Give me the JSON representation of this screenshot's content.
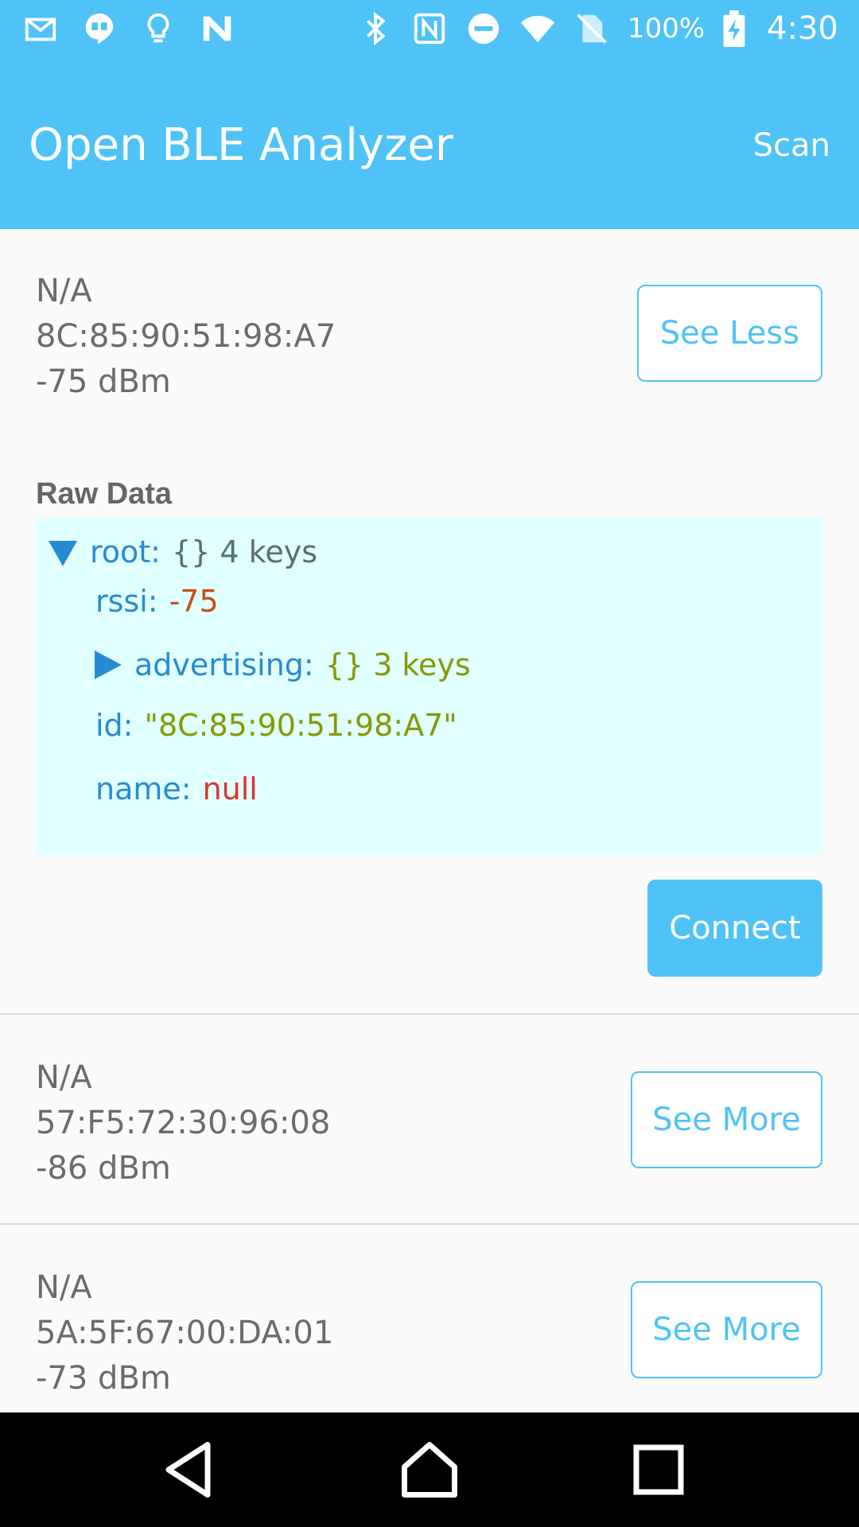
{
  "status_bar": {
    "left_icons": [
      "gmail-icon",
      "hangouts-icon",
      "lightbulb-icon",
      "n-logo-icon"
    ],
    "right_icons": [
      "bluetooth-icon",
      "nfc-icon",
      "do-not-disturb-icon",
      "wifi-icon",
      "no-sim-icon"
    ],
    "battery_percent": "100%",
    "time": "4:30"
  },
  "app_bar": {
    "title": "Open BLE Analyzer",
    "scan_label": "Scan"
  },
  "devices": [
    {
      "name": "N/A",
      "address": "8C:85:90:51:98:A7",
      "rssi": "-75 dBm",
      "toggle_label": "See Less",
      "expanded": true
    },
    {
      "name": "N/A",
      "address": "57:F5:72:30:96:08",
      "rssi": "-86 dBm",
      "toggle_label": "See More",
      "expanded": false
    },
    {
      "name": "N/A",
      "address": "5A:5F:67:00:DA:01",
      "rssi": "-73 dBm",
      "toggle_label": "See More",
      "expanded": false
    }
  ],
  "raw_data": {
    "heading": "Raw Data",
    "root_key": "root:",
    "root_summary": "{} 4 keys",
    "rssi_key": "rssi:",
    "rssi_value": "-75",
    "advertising_key": "advertising:",
    "advertising_summary": "{} 3 keys",
    "id_key": "id:",
    "id_value": "\"8C:85:90:51:98:A7\"",
    "name_key": "name:",
    "name_value": "null"
  },
  "connect_label": "Connect",
  "nav_bar": {
    "icons": [
      "back-icon",
      "home-icon",
      "recents-icon"
    ]
  },
  "colors": {
    "primary": "#4fc3f7",
    "json_background": "#e0ffff",
    "json_key": "#268bd2",
    "json_number": "#cb4b16",
    "json_string": "#859900",
    "json_null": "#dc322f"
  }
}
